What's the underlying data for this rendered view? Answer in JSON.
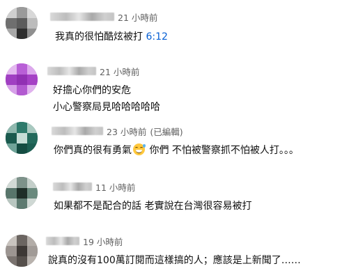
{
  "comments": [
    {
      "time": "21 小時前",
      "edited": "",
      "lines": [],
      "text_prefix": "我真的很怕酷炫被打 ",
      "timestamp": "6:12"
    },
    {
      "time": "21 小時前",
      "edited": "",
      "lines": [
        "好擔心你們的安危",
        "小心警察局見哈哈哈哈哈"
      ]
    },
    {
      "time": "23 小時前",
      "edited": "(已編輯)",
      "text_before_emoji": "你們真的很有勇氣",
      "emoji": "grinning-sweat-emoji",
      "text_after_emoji": " 你們 不怕被警察抓不怕被人打。。。"
    },
    {
      "time": "11 小時前",
      "edited": "",
      "lines": [
        "如果都不是配合的話 老實說在台灣很容易被打"
      ]
    },
    {
      "time": "19 小時前",
      "edited": "",
      "lines": [
        "說真的沒有100萬訂閱而這樣搞的人；應該是上新聞了……"
      ]
    }
  ],
  "colors": {
    "text": "#0f0f0f",
    "meta": "#606060",
    "link": "#065fd4",
    "avatar_2": "#b04fd0",
    "avatar_3": "#1f6b5e"
  }
}
